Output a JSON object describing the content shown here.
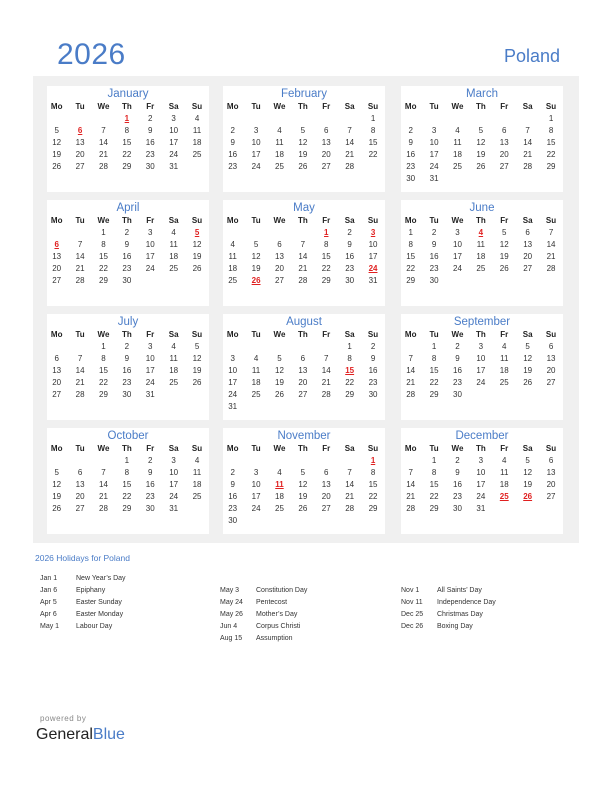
{
  "header": {
    "year": "2026",
    "country": "Poland"
  },
  "weekdays": [
    "Mo",
    "Tu",
    "We",
    "Th",
    "Fr",
    "Sa",
    "Su"
  ],
  "colors": {
    "accent": "#4a7cc7",
    "holiday": "#e02020",
    "panel": "#f0f0f0"
  },
  "months": [
    {
      "name": "January",
      "offset": 3,
      "days": 31,
      "holidays": [
        1,
        6
      ]
    },
    {
      "name": "February",
      "offset": 6,
      "days": 28,
      "holidays": []
    },
    {
      "name": "March",
      "offset": 6,
      "days": 31,
      "holidays": []
    },
    {
      "name": "April",
      "offset": 2,
      "days": 30,
      "holidays": [
        5,
        6
      ]
    },
    {
      "name": "May",
      "offset": 4,
      "days": 31,
      "holidays": [
        1,
        3,
        24,
        26
      ]
    },
    {
      "name": "June",
      "offset": 0,
      "days": 30,
      "holidays": [
        4
      ]
    },
    {
      "name": "July",
      "offset": 2,
      "days": 31,
      "holidays": []
    },
    {
      "name": "August",
      "offset": 5,
      "days": 31,
      "holidays": [
        15
      ]
    },
    {
      "name": "September",
      "offset": 1,
      "days": 30,
      "holidays": []
    },
    {
      "name": "October",
      "offset": 3,
      "days": 31,
      "holidays": []
    },
    {
      "name": "November",
      "offset": 6,
      "days": 30,
      "holidays": [
        1,
        11
      ]
    },
    {
      "name": "December",
      "offset": 1,
      "days": 31,
      "holidays": [
        25,
        26
      ]
    }
  ],
  "holidays_title": "2026 Holidays for Poland",
  "holiday_columns": [
    [
      {
        "date": "Jan 1",
        "name": "New Year’s Day"
      },
      {
        "date": "Jan 6",
        "name": "Epiphany"
      },
      {
        "date": "Apr 5",
        "name": "Easter Sunday"
      },
      {
        "date": "Apr 6",
        "name": "Easter Monday"
      },
      {
        "date": "May 1",
        "name": "Labour Day"
      }
    ],
    [
      {
        "date": "May 3",
        "name": "Constitution Day"
      },
      {
        "date": "May 24",
        "name": "Pentecost"
      },
      {
        "date": "May 26",
        "name": "Mother’s Day"
      },
      {
        "date": "Jun 4",
        "name": "Corpus Christi"
      },
      {
        "date": "Aug 15",
        "name": "Assumption"
      }
    ],
    [
      {
        "date": "Nov 1",
        "name": "All Saints’ Day"
      },
      {
        "date": "Nov 11",
        "name": "Independence Day"
      },
      {
        "date": "Dec 25",
        "name": "Christmas Day"
      },
      {
        "date": "Dec 26",
        "name": "Boxing Day"
      }
    ]
  ],
  "footer": {
    "powered_by": "powered by",
    "brand_a": "General",
    "brand_b": "Blue"
  }
}
